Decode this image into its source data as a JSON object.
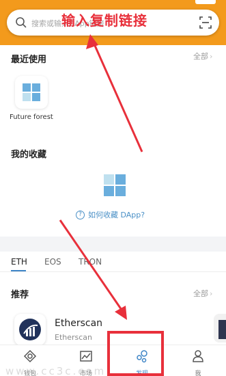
{
  "search": {
    "placeholder": "搜索或输入DApp链接"
  },
  "recent": {
    "title": "最近使用",
    "see_all": "全部",
    "apps": [
      {
        "name": "Future forest"
      }
    ]
  },
  "favorites": {
    "title": "我的收藏",
    "help_text": "如何收藏 DApp?"
  },
  "chain_tabs": [
    {
      "label": "ETH",
      "active": true
    },
    {
      "label": "EOS",
      "active": false
    },
    {
      "label": "TRON",
      "active": false
    }
  ],
  "recommended": {
    "title": "推荐",
    "see_all": "全部",
    "items": [
      {
        "name": "Etherscan",
        "subtitle": "Etherscan"
      }
    ]
  },
  "bottom_nav": [
    {
      "label": "钱包",
      "icon": "wallet-icon"
    },
    {
      "label": "市场",
      "icon": "chart-icon"
    },
    {
      "label": "发现",
      "icon": "discover-icon",
      "active": true
    },
    {
      "label": "我",
      "icon": "profile-icon"
    }
  ],
  "annotation": {
    "text": "输入复制链接",
    "color": "#e8303b"
  },
  "watermark": "www.cc3c.com",
  "colors": {
    "accent": "#3d84c6",
    "top_bar": "#f39a1c",
    "annotation": "#e8303b"
  }
}
